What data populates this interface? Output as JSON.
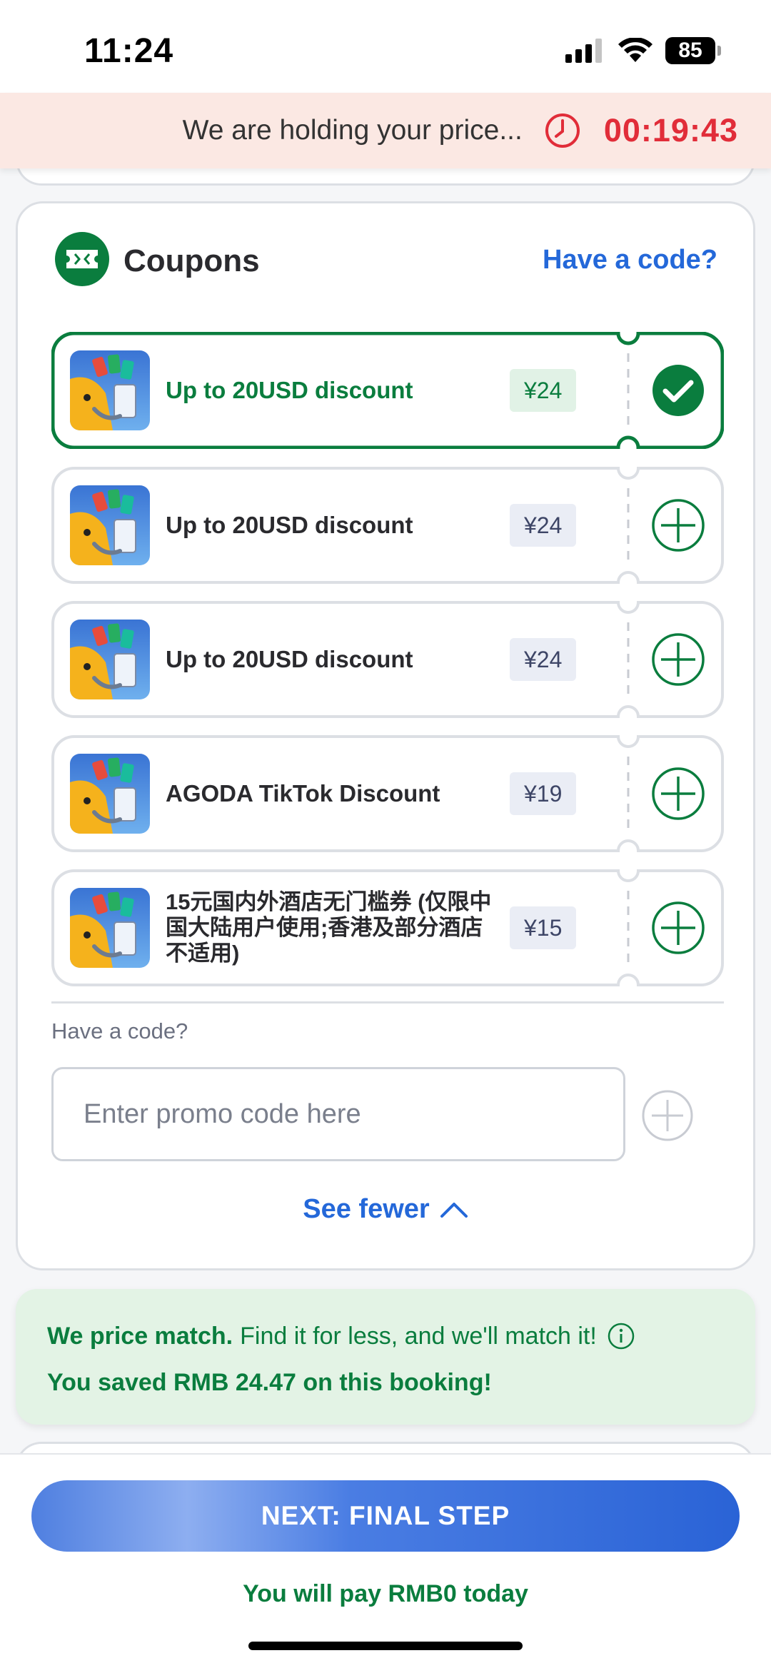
{
  "status_bar": {
    "time": "11:24",
    "battery": "85"
  },
  "hold_banner": {
    "text": "We are holding your price...",
    "timer": "00:19:43"
  },
  "coupons": {
    "title": "Coupons",
    "have_code_link": "Have a code?",
    "items": [
      {
        "name": "Up to 20USD discount",
        "amount": "¥24",
        "selected": true
      },
      {
        "name": "Up to 20USD discount",
        "amount": "¥24",
        "selected": false
      },
      {
        "name": "Up to 20USD discount",
        "amount": "¥24",
        "selected": false
      },
      {
        "name": "AGODA TikTok Discount",
        "amount": "¥19",
        "selected": false
      },
      {
        "name": "15元国内外酒店无门槛券 (仅限中国大陆用户使用;香港及部分酒店不适用)",
        "amount": "¥15",
        "selected": false
      }
    ],
    "promo_label": "Have a code?",
    "promo_placeholder": "Enter promo code here",
    "see_fewer": "See fewer"
  },
  "price_match": {
    "bold": "We price match.",
    "text": "Find it for less, and we'll match it!",
    "saved": "You saved RMB 24.47 on this booking!"
  },
  "footer": {
    "next_button": "NEXT: FINAL STEP",
    "pay_today": "You will pay RMB0 today"
  },
  "colors": {
    "brand_green": "#0a7d3e",
    "link_blue": "#2468d9",
    "timer_red": "#e12d39",
    "banner_bg": "#fbe8e3"
  }
}
